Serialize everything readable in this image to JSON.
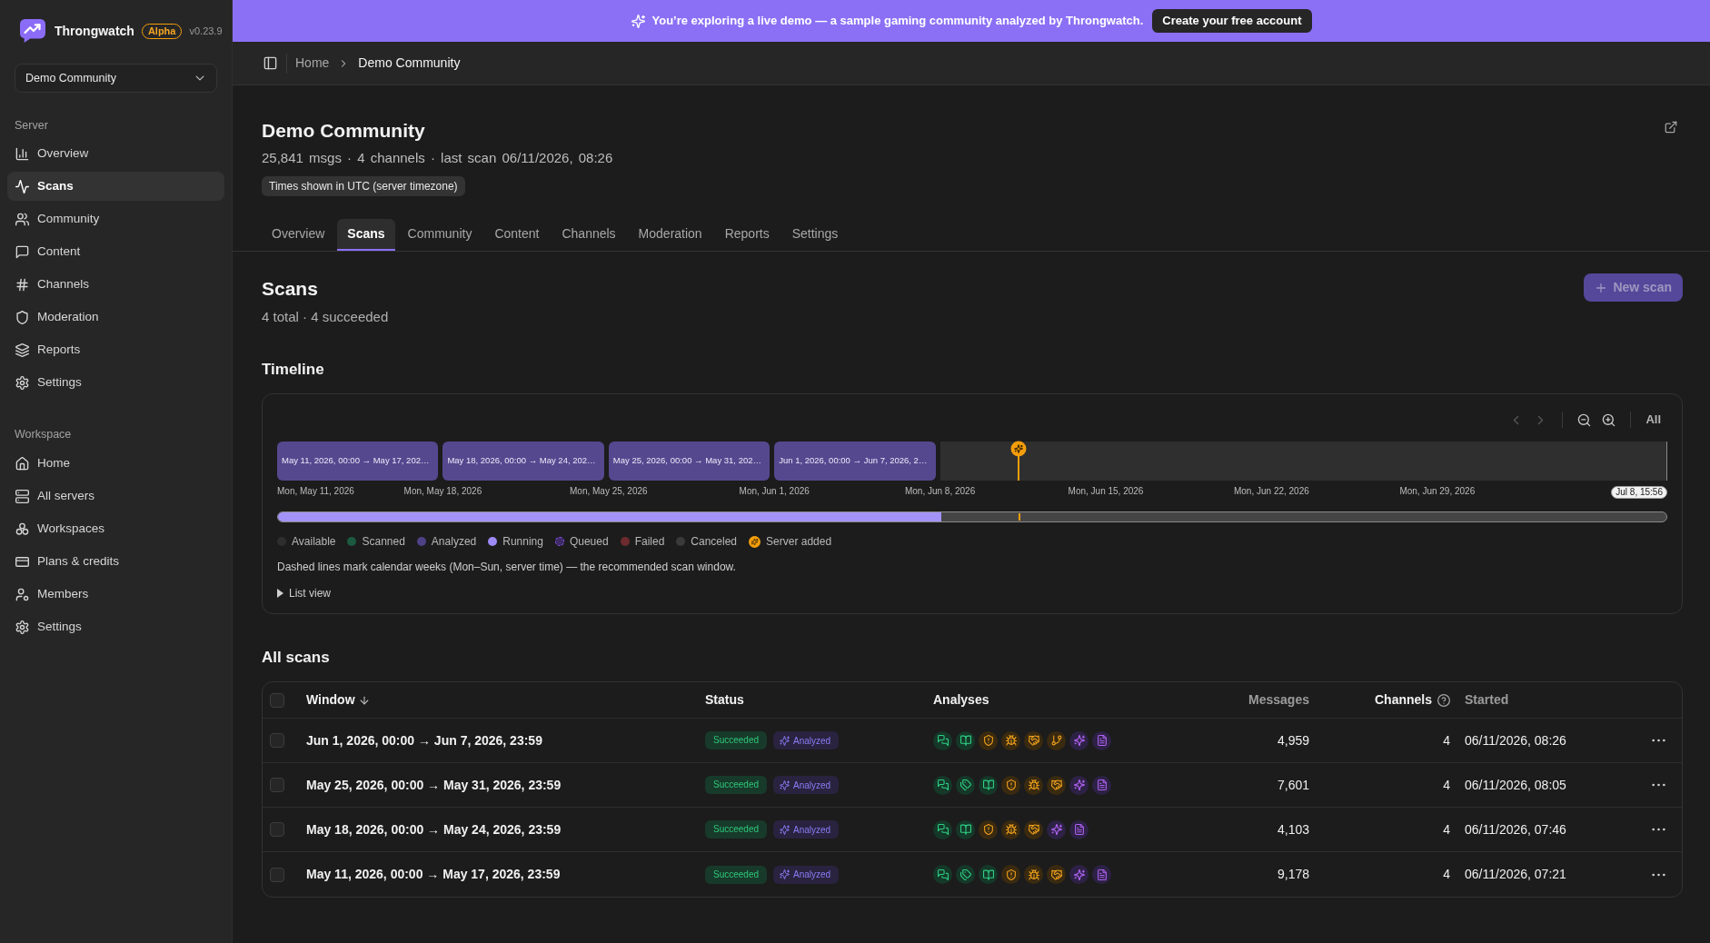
{
  "sidebar": {
    "brand": {
      "name": "Throngwatch",
      "badge": "Alpha",
      "version": "v0.23.9"
    },
    "server_picker": {
      "value": "Demo Community"
    },
    "sections": [
      {
        "title": "Server",
        "items": [
          {
            "label": "Overview",
            "selected": false
          },
          {
            "label": "Scans",
            "selected": true
          },
          {
            "label": "Community",
            "selected": false
          },
          {
            "label": "Content",
            "selected": false
          },
          {
            "label": "Channels",
            "selected": false
          },
          {
            "label": "Moderation",
            "selected": false
          },
          {
            "label": "Reports",
            "selected": false
          },
          {
            "label": "Settings",
            "selected": false
          }
        ]
      },
      {
        "title": "Workspace",
        "items": [
          {
            "label": "Home",
            "selected": false
          },
          {
            "label": "All servers",
            "selected": false
          },
          {
            "label": "Workspaces",
            "selected": false
          },
          {
            "label": "Plans & credits",
            "selected": false
          },
          {
            "label": "Members",
            "selected": false
          },
          {
            "label": "Settings",
            "selected": false
          }
        ]
      }
    ]
  },
  "banner": {
    "text": "You’re exploring a live demo — a sample gaming community analyzed by Throngwatch.",
    "button": "Create your free account"
  },
  "breadcrumb": [
    {
      "label": "Home",
      "current": false
    },
    {
      "label": "Demo Community",
      "current": true
    }
  ],
  "header": {
    "title": "Demo Community",
    "stats": "25,841 msgs · 4 channels · last scan 06/11/2026, 08:26",
    "timezone_note": "Times shown in UTC (server timezone)"
  },
  "tabs": [
    {
      "label": "Overview",
      "selected": false
    },
    {
      "label": "Scans",
      "selected": true
    },
    {
      "label": "Community",
      "selected": false
    },
    {
      "label": "Content",
      "selected": false
    },
    {
      "label": "Channels",
      "selected": false
    },
    {
      "label": "Moderation",
      "selected": false
    },
    {
      "label": "Reports",
      "selected": false
    },
    {
      "label": "Settings",
      "selected": false
    }
  ],
  "scans": {
    "title": "Scans",
    "summary": "4 total · 4 succeeded",
    "new_scan_button": {
      "label": "New scan",
      "disabled": true
    }
  },
  "timeline": {
    "title": "Timeline",
    "controls": [
      {
        "kind": "prev",
        "disabled": true
      },
      {
        "kind": "next",
        "disabled": true
      },
      {
        "kind": "zoom_out",
        "disabled": false
      },
      {
        "kind": "zoom_in",
        "disabled": false
      },
      {
        "kind": "all",
        "label": "All",
        "disabled": false
      }
    ],
    "blocks": [
      {
        "label": "May 11, 2026, 00:00 → May 17, 202…",
        "kind": "analyzed"
      },
      {
        "label": "May 18, 2026, 00:00 → May 24, 202…",
        "kind": "analyzed"
      },
      {
        "label": "May 25, 2026, 00:00 → May 31, 202…",
        "kind": "analyzed"
      },
      {
        "label": "Jun 1, 2026, 00:00 → Jun 7, 2026, 2…",
        "kind": "analyzed"
      }
    ],
    "markers": [
      {
        "kind": "server_added"
      }
    ],
    "axis_labels": [
      "Mon, May 11, 2026",
      "Mon, May 18, 2026",
      "Mon, May 25, 2026",
      "Mon, Jun 1, 2026",
      "Mon, Jun 8, 2026",
      "Mon, Jun 15, 2026",
      "Mon, Jun 22, 2026",
      "Mon, Jun 29, 2026"
    ],
    "end_label": "Jul 8, 15:56",
    "legend": [
      {
        "label": "Available",
        "kind": "dot",
        "color": "#2e2e2e"
      },
      {
        "label": "Scanned",
        "kind": "dot",
        "color": "#1c5a40"
      },
      {
        "label": "Analyzed",
        "kind": "dot",
        "color": "#4e4185"
      },
      {
        "label": "Running",
        "kind": "dot",
        "color": "#9d8af7"
      },
      {
        "label": "Queued",
        "kind": "ring",
        "color": "#3f2a68"
      },
      {
        "label": "Failed",
        "kind": "dot",
        "color": "#6d2b2f"
      },
      {
        "label": "Canceled",
        "kind": "dot",
        "color": "#3a3a3a"
      },
      {
        "label": "Server added",
        "kind": "marker",
        "color": "#f59e0b"
      }
    ],
    "note": "Dashed lines mark calendar weeks (Mon–Sun, server time) — the recommended scan window.",
    "list_view": {
      "label": "List view",
      "expanded": false
    }
  },
  "all_scans": {
    "title": "All scans",
    "table": {
      "select_all": {
        "checked": false
      },
      "columns": [
        {
          "label": "Window",
          "sortable": true,
          "sorted": true
        },
        {
          "label": "Status",
          "sortable": false,
          "sorted": false
        },
        {
          "label": "Analyses",
          "sortable": false,
          "sorted": false
        },
        {
          "label": "Messages",
          "sortable": true,
          "sorted": false
        },
        {
          "label": "Channels",
          "sortable": false,
          "sorted": false,
          "help": true
        },
        {
          "label": "Started",
          "sortable": true,
          "sorted": false
        }
      ],
      "rows": [
        {
          "selected": false,
          "window": "Jun 1, 2026, 00:00 → Jun 7, 2026, 23:59",
          "status": [
            {
              "label": "Succeeded",
              "kind": "success"
            },
            {
              "label": "Analyzed",
              "kind": "analyzed"
            }
          ],
          "analyses": [
            {
              "kind": "chat"
            },
            {
              "kind": "book"
            },
            {
              "kind": "shield"
            },
            {
              "kind": "bug"
            },
            {
              "kind": "handshake"
            },
            {
              "kind": "branch"
            },
            {
              "kind": "sparkles"
            },
            {
              "kind": "file"
            }
          ],
          "messages": "4,959",
          "channels": "4",
          "started": "06/11/2026, 08:26"
        },
        {
          "selected": false,
          "window": "May 25, 2026, 00:00 → May 31, 2026, 23:59",
          "status": [
            {
              "label": "Succeeded",
              "kind": "success"
            },
            {
              "label": "Analyzed",
              "kind": "analyzed"
            }
          ],
          "analyses": [
            {
              "kind": "chat"
            },
            {
              "kind": "tags"
            },
            {
              "kind": "book"
            },
            {
              "kind": "shield"
            },
            {
              "kind": "bug"
            },
            {
              "kind": "handshake"
            },
            {
              "kind": "sparkles"
            },
            {
              "kind": "file"
            }
          ],
          "messages": "7,601",
          "channels": "4",
          "started": "06/11/2026, 08:05"
        },
        {
          "selected": false,
          "window": "May 18, 2026, 00:00 → May 24, 2026, 23:59",
          "status": [
            {
              "label": "Succeeded",
              "kind": "success"
            },
            {
              "label": "Analyzed",
              "kind": "analyzed"
            }
          ],
          "analyses": [
            {
              "kind": "chat"
            },
            {
              "kind": "book"
            },
            {
              "kind": "shield"
            },
            {
              "kind": "bug"
            },
            {
              "kind": "handshake"
            },
            {
              "kind": "sparkles"
            },
            {
              "kind": "file"
            }
          ],
          "messages": "4,103",
          "channels": "4",
          "started": "06/11/2026, 07:46"
        },
        {
          "selected": false,
          "window": "May 11, 2026, 00:00 → May 17, 2026, 23:59",
          "status": [
            {
              "label": "Succeeded",
              "kind": "success"
            },
            {
              "label": "Analyzed",
              "kind": "analyzed"
            }
          ],
          "analyses": [
            {
              "kind": "chat"
            },
            {
              "kind": "tags"
            },
            {
              "kind": "book"
            },
            {
              "kind": "shield"
            },
            {
              "kind": "bug"
            },
            {
              "kind": "handshake"
            },
            {
              "kind": "sparkles"
            },
            {
              "kind": "file"
            }
          ],
          "messages": "9,178",
          "channels": "4",
          "started": "06/11/2026, 07:21"
        }
      ]
    }
  }
}
